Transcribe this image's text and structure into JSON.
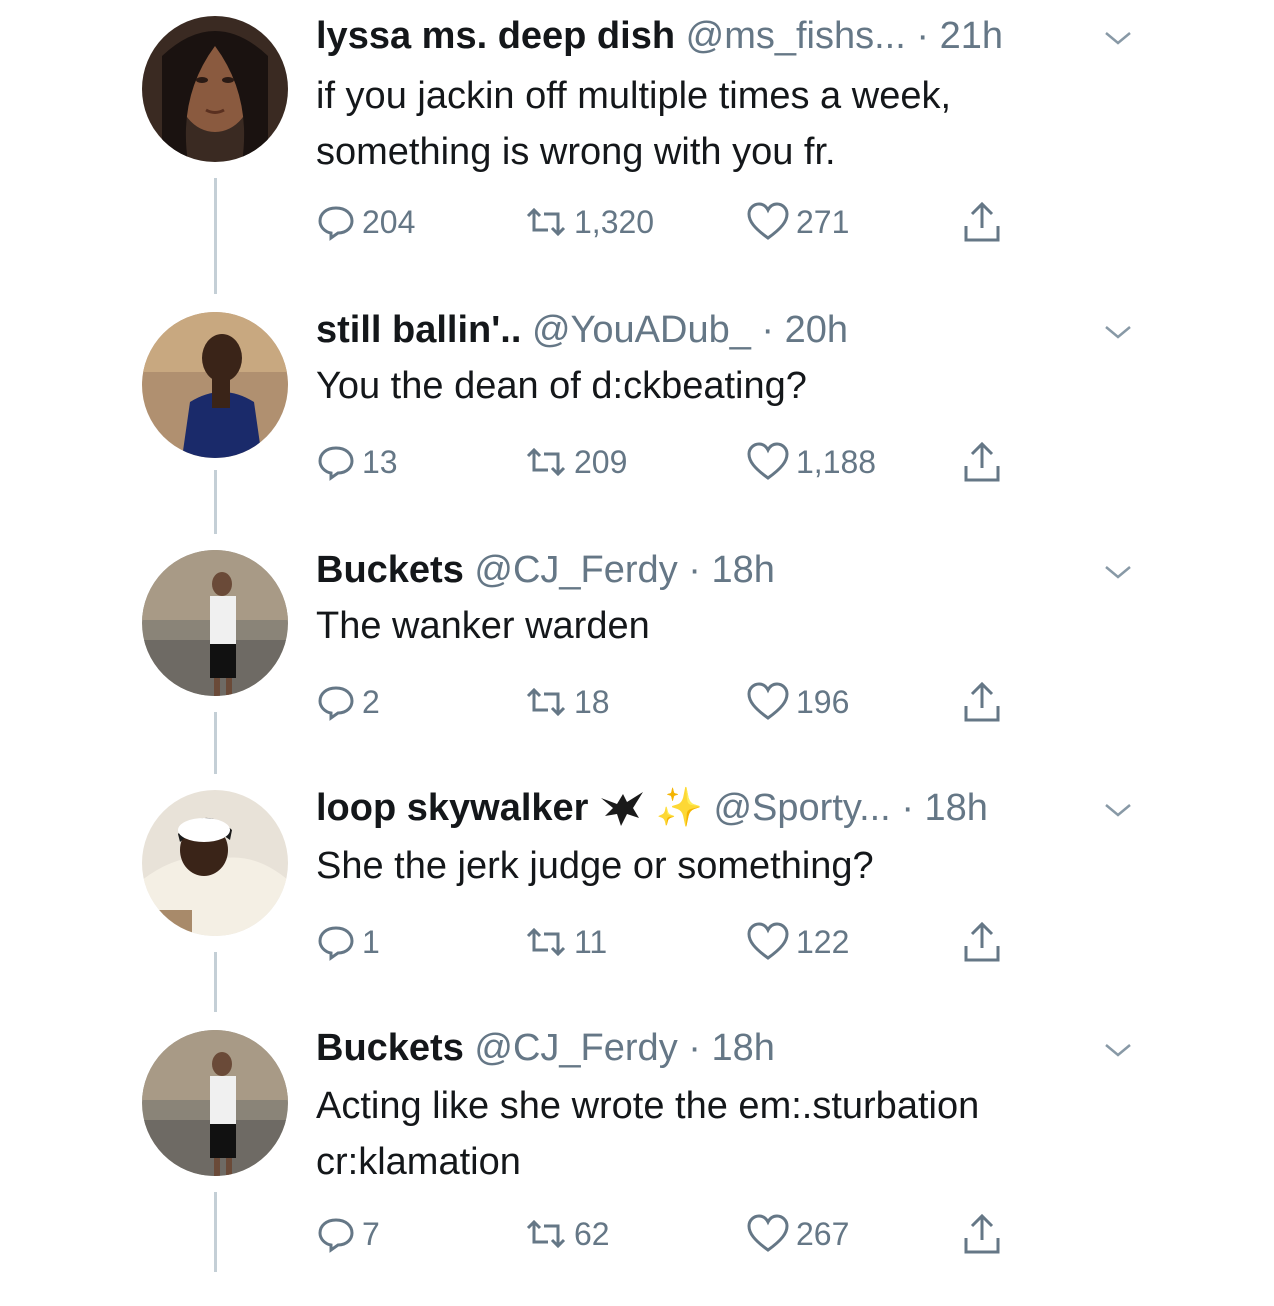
{
  "tweets": [
    {
      "name": "lyssa ms. deep dish",
      "handle": "@ms_fishs...",
      "dot": "·",
      "time": "21h",
      "lines": [
        "if you jackin off multiple times a week,",
        "something is wrong with you fr."
      ],
      "replies": "204",
      "retweets": "1,320",
      "likes": "271"
    },
    {
      "name": "still ballin'..",
      "handle": "@YouADub_",
      "dot": "·",
      "time": "20h",
      "lines": [
        "You the dean of d:ckbeating?"
      ],
      "replies": "13",
      "retweets": "209",
      "likes": "1,188"
    },
    {
      "name": "Buckets",
      "handle": "@CJ_Ferdy",
      "dot": "·",
      "time": "18h",
      "lines": [
        "The wanker warden"
      ],
      "replies": "2",
      "retweets": "18",
      "likes": "196"
    },
    {
      "name": "loop skywalker",
      "handle": "@Sporty...",
      "dot": "·",
      "time": "18h",
      "emoji": "✨",
      "lines": [
        "She the jerk judge or something?"
      ],
      "replies": "1",
      "retweets": "11",
      "likes": "122"
    },
    {
      "name": "Buckets",
      "handle": "@CJ_Ferdy",
      "dot": "·",
      "time": "18h",
      "lines": [
        "Acting like she wrote the em:.sturbation",
        "cr:klamation"
      ],
      "replies": "7",
      "retweets": "62",
      "likes": "267"
    }
  ],
  "colors": {
    "text": "#14171a",
    "muted": "#657786",
    "thread_line": "#c4cfd6"
  },
  "icons": [
    "reply-icon",
    "retweet-icon",
    "like-icon",
    "share-icon",
    "chevron-down-icon",
    "eagle-emoji-icon",
    "sparkles-emoji-icon"
  ]
}
